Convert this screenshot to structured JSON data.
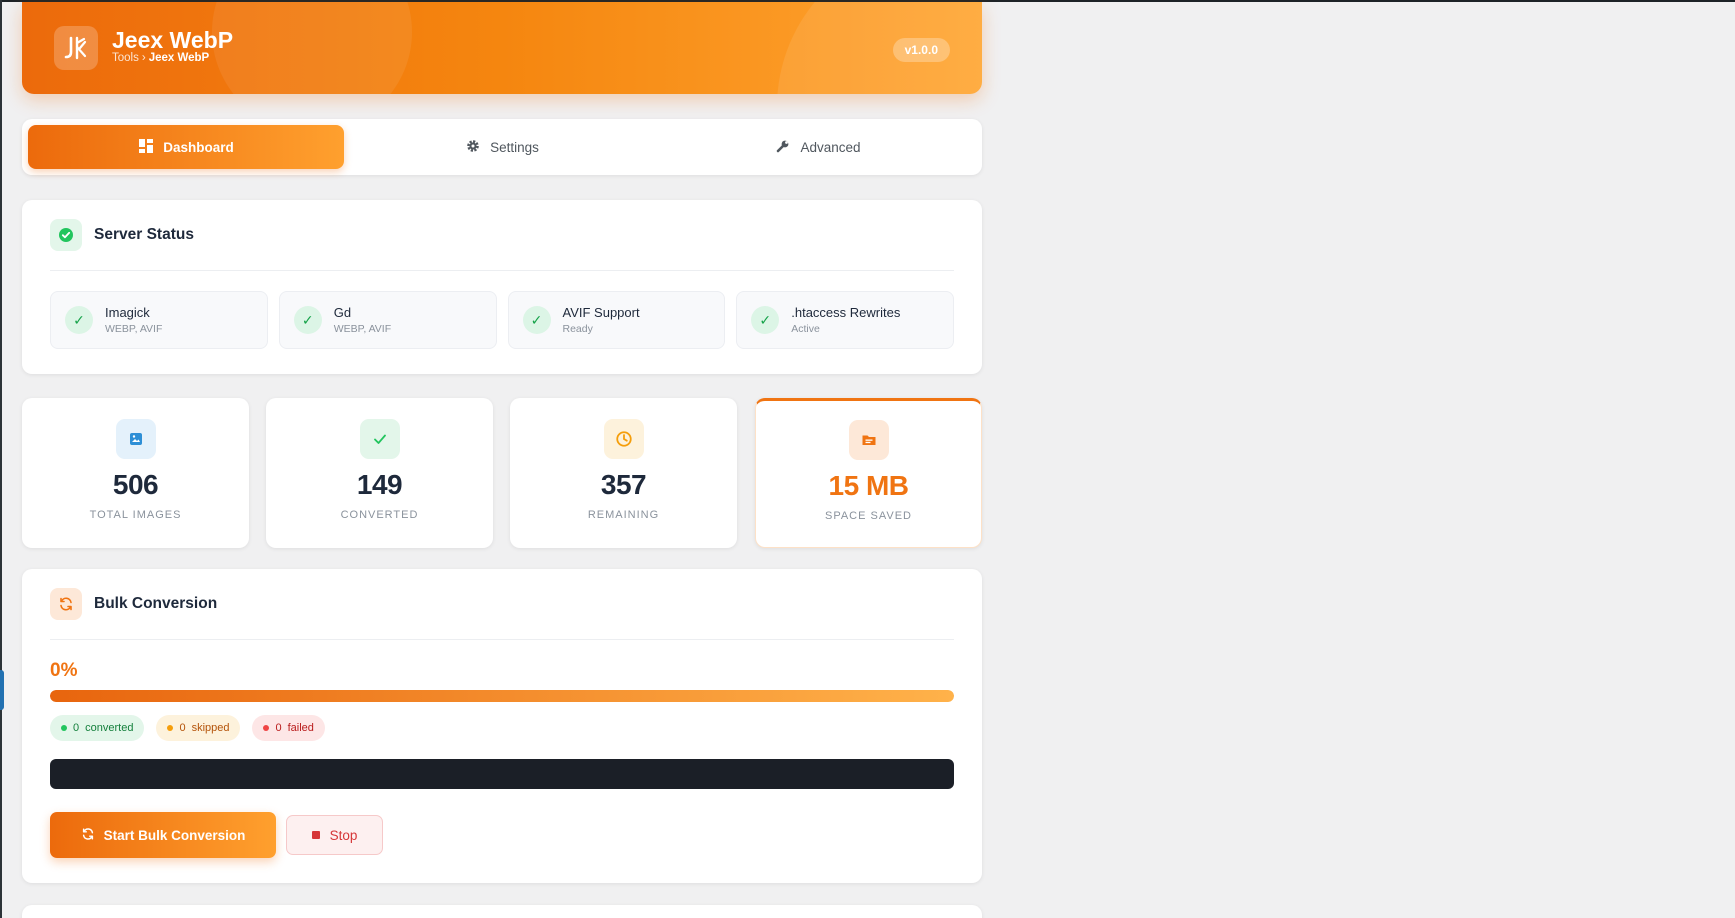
{
  "header": {
    "title": "Jeex WebP",
    "breadcrumb_parent": "Tools",
    "breadcrumb_sep": "›",
    "breadcrumb_current": "Jeex WebP",
    "version": "v1.0.0",
    "logo_icon": "jx-logo-icon"
  },
  "tabs": [
    {
      "label": "Dashboard",
      "icon": "dashboard-icon",
      "active": true
    },
    {
      "label": "Settings",
      "icon": "gear-icon",
      "active": false
    },
    {
      "label": "Advanced",
      "icon": "wrench-icon",
      "active": false
    }
  ],
  "server_status": {
    "title": "Server Status",
    "items": [
      {
        "name": "Imagick",
        "sub": "WEBP, AVIF"
      },
      {
        "name": "Gd",
        "sub": "WEBP, AVIF"
      },
      {
        "name": "AVIF Support",
        "sub": "Ready"
      },
      {
        "name": ".htaccess Rewrites",
        "sub": "Active"
      }
    ]
  },
  "stats": [
    {
      "value": "506",
      "label": "TOTAL IMAGES",
      "icon": "image-icon",
      "color": "#2e8fd6"
    },
    {
      "value": "149",
      "label": "CONVERTED",
      "icon": "check-icon",
      "color": "#22c55e"
    },
    {
      "value": "357",
      "label": "REMAINING",
      "icon": "clock-icon",
      "color": "#f59e0b"
    },
    {
      "value": "15 MB",
      "label": "SPACE SAVED",
      "icon": "folder-icon",
      "color": "#f07412"
    }
  ],
  "bulk": {
    "title": "Bulk Conversion",
    "percent_text": "0%",
    "progress": 1.0,
    "converted_count": "0",
    "converted_label": "converted",
    "skipped_count": "0",
    "skipped_label": "skipped",
    "failed_count": "0",
    "failed_label": "failed",
    "start_label": "Start Bulk Conversion",
    "stop_label": "Stop"
  },
  "colors": {
    "accent": "#f07412",
    "accent_light": "#ffa531",
    "success": "#22c55e",
    "danger": "#d63638"
  }
}
